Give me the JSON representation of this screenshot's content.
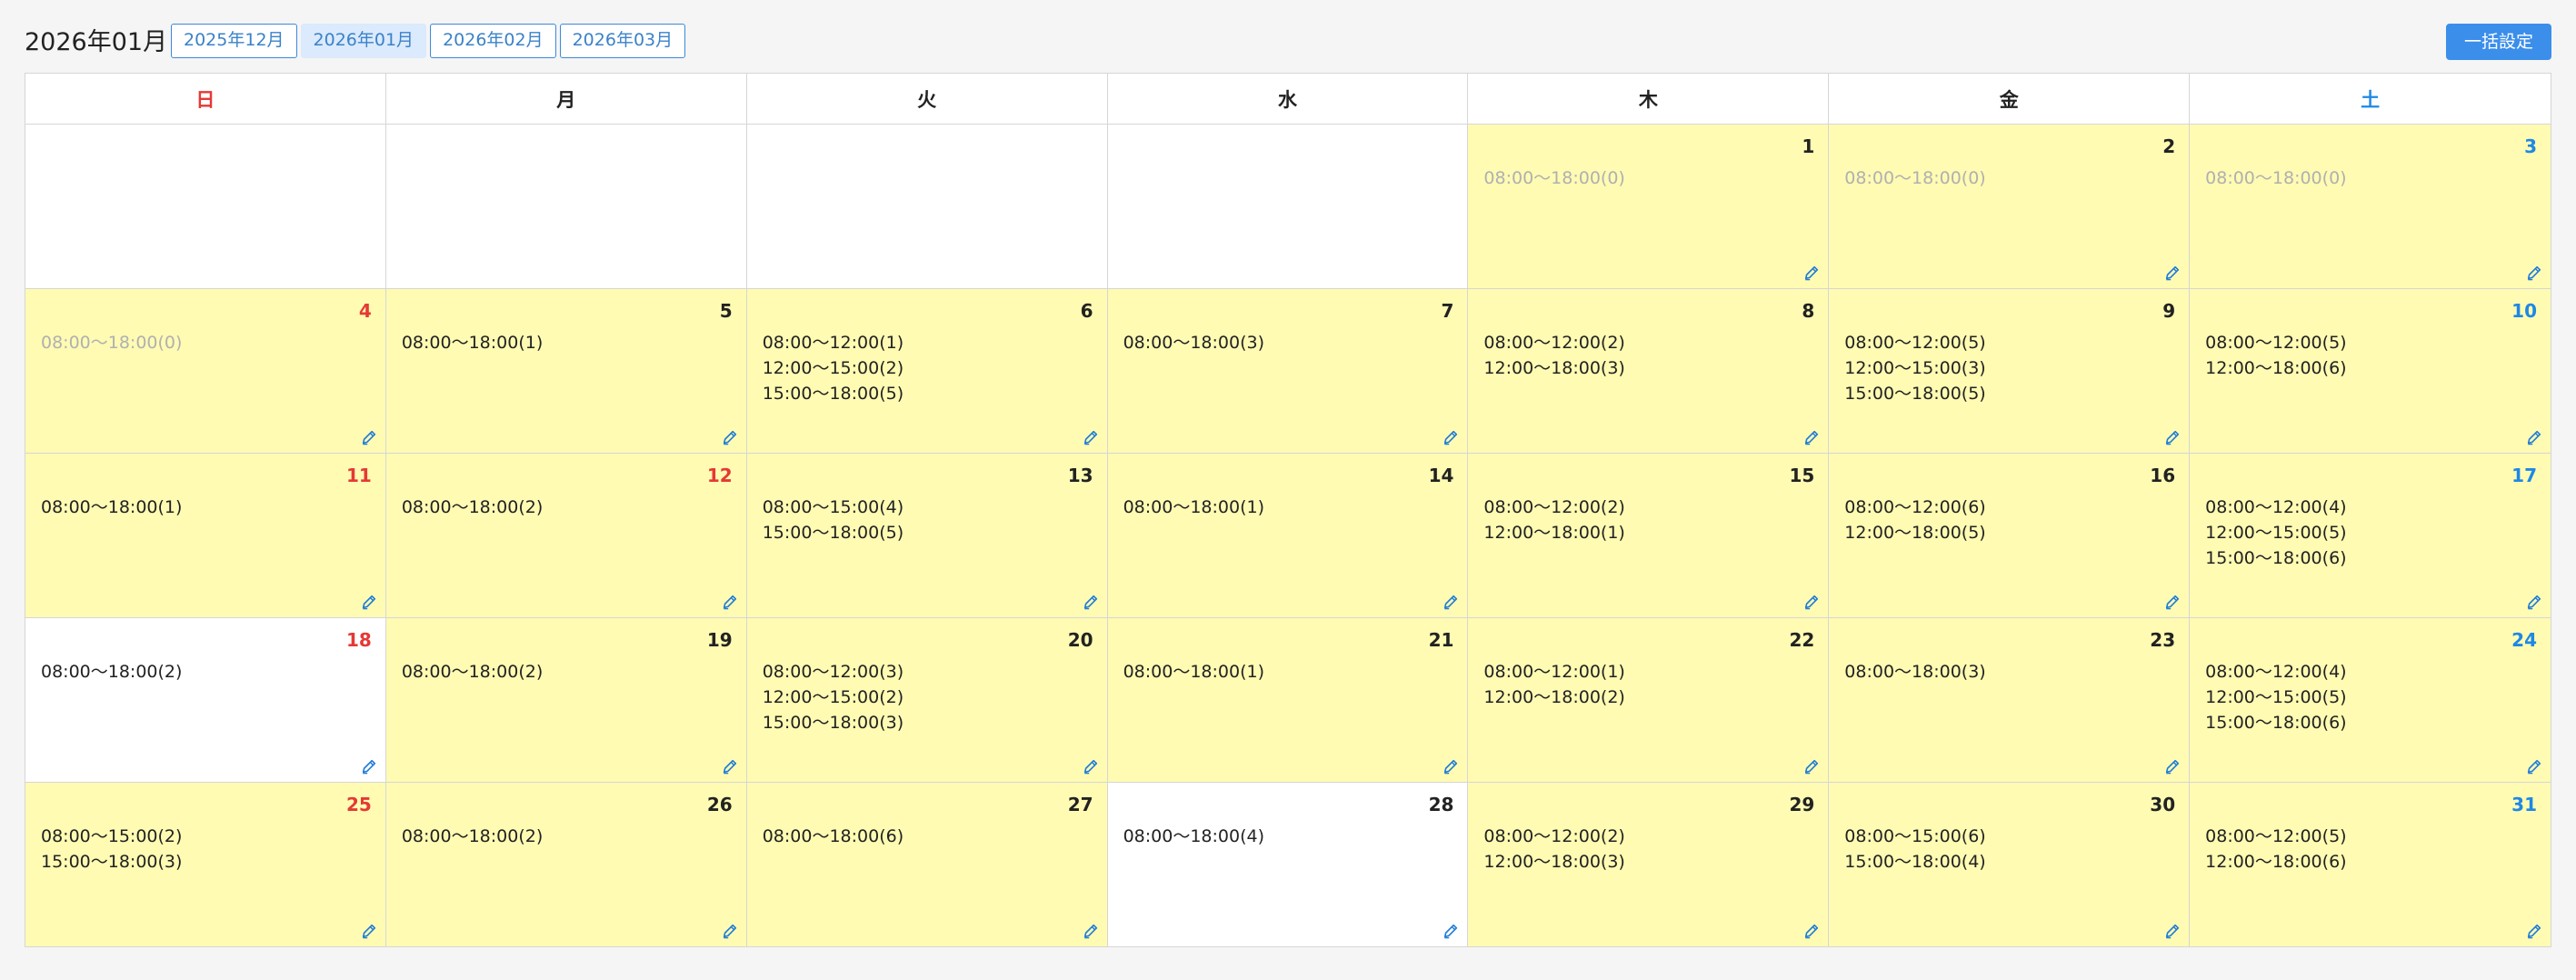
{
  "header": {
    "title": "2026年01月",
    "tabs": [
      {
        "label": "2025年12月",
        "active": false
      },
      {
        "label": "2026年01月",
        "active": true
      },
      {
        "label": "2026年02月",
        "active": false
      },
      {
        "label": "2026年03月",
        "active": false
      }
    ],
    "bulk_button_label": "一括設定"
  },
  "colors": {
    "highlight_day": "#fffbb3",
    "sunday": "#e53935",
    "saturday": "#1e88e5",
    "accent": "#3b8eea"
  },
  "calendar": {
    "weekdays": [
      "日",
      "月",
      "火",
      "水",
      "木",
      "金",
      "土"
    ],
    "cells": [
      {
        "day": "",
        "highlight": false,
        "slots": []
      },
      {
        "day": "",
        "highlight": false,
        "slots": []
      },
      {
        "day": "",
        "highlight": false,
        "slots": []
      },
      {
        "day": "",
        "highlight": false,
        "slots": []
      },
      {
        "day": "1",
        "highlight": true,
        "dim": true,
        "slots": [
          "08:00〜18:00(0)"
        ]
      },
      {
        "day": "2",
        "highlight": true,
        "dim": true,
        "slots": [
          "08:00〜18:00(0)"
        ]
      },
      {
        "day": "3",
        "highlight": true,
        "dim": true,
        "slots": [
          "08:00〜18:00(0)"
        ]
      },
      {
        "day": "4",
        "highlight": true,
        "dim": true,
        "slots": [
          "08:00〜18:00(0)"
        ]
      },
      {
        "day": "5",
        "highlight": true,
        "slots": [
          "08:00〜18:00(1)"
        ]
      },
      {
        "day": "6",
        "highlight": true,
        "slots": [
          "08:00〜12:00(1)",
          "12:00〜15:00(2)",
          "15:00〜18:00(5)"
        ]
      },
      {
        "day": "7",
        "highlight": true,
        "slots": [
          "08:00〜18:00(3)"
        ]
      },
      {
        "day": "8",
        "highlight": true,
        "slots": [
          "08:00〜12:00(2)",
          "12:00〜18:00(3)"
        ]
      },
      {
        "day": "9",
        "highlight": true,
        "slots": [
          "08:00〜12:00(5)",
          "12:00〜15:00(3)",
          "15:00〜18:00(5)"
        ]
      },
      {
        "day": "10",
        "highlight": true,
        "slots": [
          "08:00〜12:00(5)",
          "12:00〜18:00(6)"
        ]
      },
      {
        "day": "11",
        "highlight": true,
        "slots": [
          "08:00〜18:00(1)"
        ]
      },
      {
        "day": "12",
        "highlight": true,
        "holiday": true,
        "slots": [
          "08:00〜18:00(2)"
        ]
      },
      {
        "day": "13",
        "highlight": true,
        "slots": [
          "08:00〜15:00(4)",
          "15:00〜18:00(5)"
        ]
      },
      {
        "day": "14",
        "highlight": true,
        "slots": [
          "08:00〜18:00(1)"
        ]
      },
      {
        "day": "15",
        "highlight": true,
        "slots": [
          "08:00〜12:00(2)",
          "12:00〜18:00(1)"
        ]
      },
      {
        "day": "16",
        "highlight": true,
        "slots": [
          "08:00〜12:00(6)",
          "12:00〜18:00(5)"
        ]
      },
      {
        "day": "17",
        "highlight": true,
        "slots": [
          "08:00〜12:00(4)",
          "12:00〜15:00(5)",
          "15:00〜18:00(6)"
        ]
      },
      {
        "day": "18",
        "highlight": false,
        "slots": [
          "08:00〜18:00(2)"
        ]
      },
      {
        "day": "19",
        "highlight": true,
        "slots": [
          "08:00〜18:00(2)"
        ]
      },
      {
        "day": "20",
        "highlight": true,
        "slots": [
          "08:00〜12:00(3)",
          "12:00〜15:00(2)",
          "15:00〜18:00(3)"
        ]
      },
      {
        "day": "21",
        "highlight": true,
        "slots": [
          "08:00〜18:00(1)"
        ]
      },
      {
        "day": "22",
        "highlight": true,
        "slots": [
          "08:00〜12:00(1)",
          "12:00〜18:00(2)"
        ]
      },
      {
        "day": "23",
        "highlight": true,
        "slots": [
          "08:00〜18:00(3)"
        ]
      },
      {
        "day": "24",
        "highlight": true,
        "slots": [
          "08:00〜12:00(4)",
          "12:00〜15:00(5)",
          "15:00〜18:00(6)"
        ]
      },
      {
        "day": "25",
        "highlight": true,
        "slots": [
          "08:00〜15:00(2)",
          "15:00〜18:00(3)"
        ]
      },
      {
        "day": "26",
        "highlight": true,
        "slots": [
          "08:00〜18:00(2)"
        ]
      },
      {
        "day": "27",
        "highlight": true,
        "slots": [
          "08:00〜18:00(6)"
        ]
      },
      {
        "day": "28",
        "highlight": false,
        "slots": [
          "08:00〜18:00(4)"
        ]
      },
      {
        "day": "29",
        "highlight": true,
        "slots": [
          "08:00〜12:00(2)",
          "12:00〜18:00(3)"
        ]
      },
      {
        "day": "30",
        "highlight": true,
        "slots": [
          "08:00〜15:00(6)",
          "15:00〜18:00(4)"
        ]
      },
      {
        "day": "31",
        "highlight": true,
        "slots": [
          "08:00〜12:00(5)",
          "12:00〜18:00(6)"
        ]
      }
    ]
  }
}
